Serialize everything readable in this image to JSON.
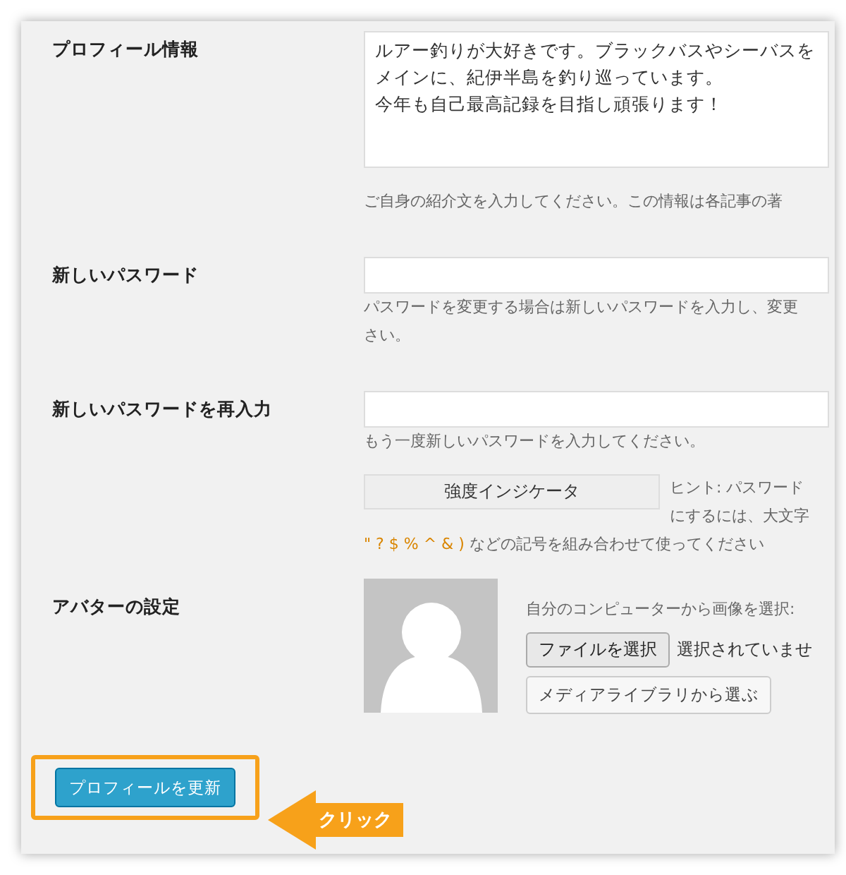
{
  "profile": {
    "label": "プロフィール情報",
    "lines": [
      "ルアー釣りが大好きです。ブラックバスやシーバスを",
      "メインに、紀伊半島を釣り巡っています。",
      "今年も自己最高記録を目指し頑張ります！"
    ],
    "hint": "ご自身の紹介文を入力してください。この情報は各記事の著"
  },
  "new_password": {
    "label": "新しいパスワード",
    "hint_lines": [
      "パスワードを変更する場合は新しいパスワードを入力し、変更",
      "さい。"
    ]
  },
  "confirm_password": {
    "label": "新しいパスワードを再入力",
    "hint": "もう一度新しいパスワードを入力してください。"
  },
  "strength": {
    "label": "強度インジケータ",
    "hint_lines": [
      "ヒント: パスワード",
      "にするには、大文字"
    ],
    "symbols": "\" ? $ % ^ & )",
    "symbols_rest": " などの記号を組み合わせて使ってください"
  },
  "avatar": {
    "label": "アバターの設定",
    "upload_label": "自分のコンピューターから画像を選択:",
    "file_button": "ファイルを選択",
    "file_status": "選択されていませ",
    "media_button": "メディアライブラリから選ぶ"
  },
  "submit": {
    "label": "プロフィールを更新",
    "highlighted": true
  },
  "callout": {
    "label": "クリック"
  }
}
